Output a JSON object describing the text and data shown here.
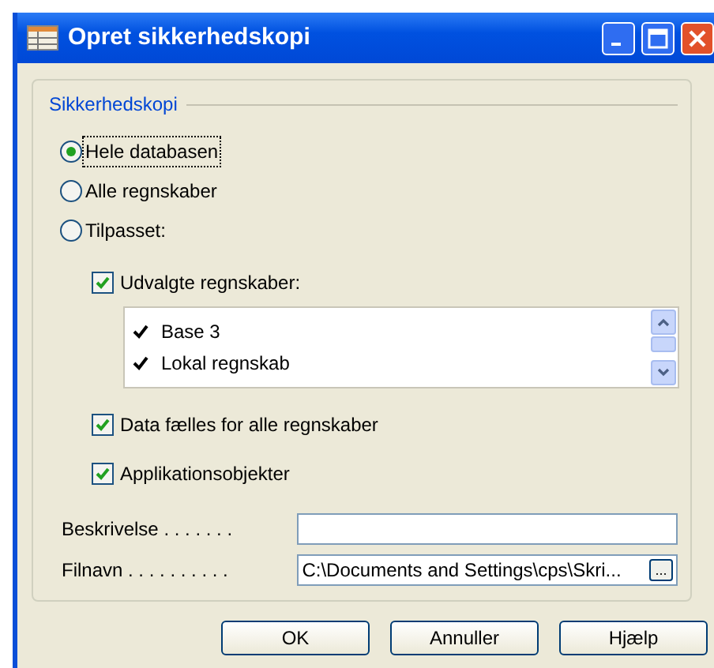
{
  "window": {
    "title": "Opret sikkerhedskopi"
  },
  "group": {
    "legend": "Sikkerhedskopi",
    "scope_options": [
      {
        "label": "Hele databasen",
        "selected": true,
        "focused": true
      },
      {
        "label": "Alle regnskaber",
        "selected": false,
        "focused": false
      },
      {
        "label": "Tilpasset:",
        "selected": false,
        "focused": false
      }
    ],
    "selected_companies": {
      "label": "Udvalgte regnskaber:",
      "checked": true,
      "items": [
        {
          "label": "Base 3",
          "checked": true
        },
        {
          "label": "Lokal regnskab",
          "checked": true
        }
      ]
    },
    "checkboxes": [
      {
        "label": "Data fælles for alle regnskaber",
        "checked": true
      },
      {
        "label": "Applikationsobjekter",
        "checked": true
      }
    ],
    "fields": [
      {
        "label": "Beskrivelse . . . . . . ."
      },
      {
        "label": "Filnavn . . . . . . . . . .",
        "value": "C:\\Documents and Settings\\cps\\Skri...",
        "browse": "..."
      }
    ]
  },
  "buttons": [
    "OK",
    "Annuller",
    "Hjælp"
  ]
}
